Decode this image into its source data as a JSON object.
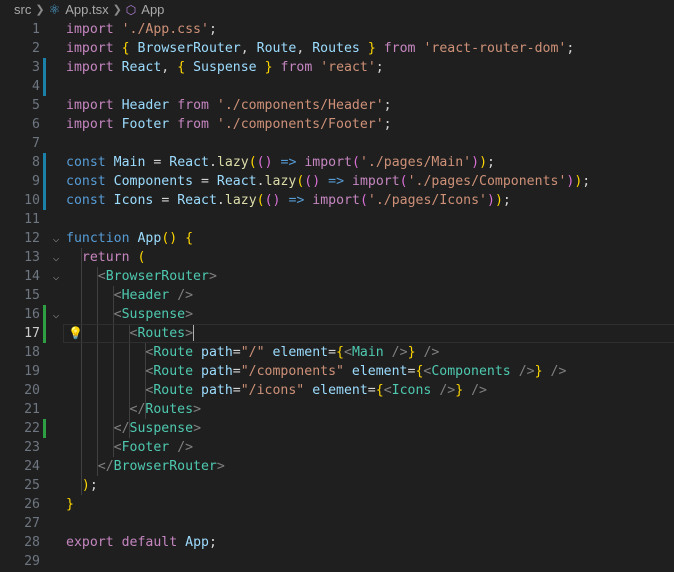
{
  "breadcrumb": {
    "folder": "src",
    "file": "App.tsx",
    "symbol": "App"
  },
  "editor": {
    "active_line": 17,
    "lines": [
      {
        "n": "1",
        "t": "import './App.css';"
      },
      {
        "n": "2",
        "t": "import { BrowserRouter, Route, Routes } from 'react-router-dom';"
      },
      {
        "n": "3",
        "t": "import React, { Suspense } from 'react';"
      },
      {
        "n": "4",
        "t": ""
      },
      {
        "n": "5",
        "t": "import Header from './components/Header';"
      },
      {
        "n": "6",
        "t": "import Footer from './components/Footer';"
      },
      {
        "n": "7",
        "t": ""
      },
      {
        "n": "8",
        "t": "const Main = React.lazy(() => import('./pages/Main'));"
      },
      {
        "n": "9",
        "t": "const Components = React.lazy(() => import('./pages/Components'));"
      },
      {
        "n": "10",
        "t": "const Icons = React.lazy(() => import('./pages/Icons'));"
      },
      {
        "n": "11",
        "t": ""
      },
      {
        "n": "12",
        "t": "function App() {"
      },
      {
        "n": "13",
        "t": "  return ("
      },
      {
        "n": "14",
        "t": "    <BrowserRouter>"
      },
      {
        "n": "15",
        "t": "      <Header />"
      },
      {
        "n": "16",
        "t": "      <Suspense>"
      },
      {
        "n": "17",
        "t": "        <Routes>"
      },
      {
        "n": "18",
        "t": "          <Route path=\"/\" element={<Main />} />"
      },
      {
        "n": "19",
        "t": "          <Route path=\"/components\" element={<Components />} />"
      },
      {
        "n": "20",
        "t": "          <Route path=\"/icons\" element={<Icons />} />"
      },
      {
        "n": "21",
        "t": "        </Routes>"
      },
      {
        "n": "22",
        "t": "      </Suspense>"
      },
      {
        "n": "23",
        "t": "      <Footer />"
      },
      {
        "n": "24",
        "t": "    </BrowserRouter>"
      },
      {
        "n": "25",
        "t": "  );"
      },
      {
        "n": "26",
        "t": "}"
      },
      {
        "n": "27",
        "t": ""
      },
      {
        "n": "28",
        "t": "export default App;"
      },
      {
        "n": "29",
        "t": ""
      }
    ]
  },
  "colors": {
    "background": "#1f1f1f",
    "keyword": "#c586c0",
    "storage": "#569cd6",
    "string": "#ce9178",
    "variable": "#9cdcfe",
    "type": "#4ec9b0",
    "function": "#dcdcaa",
    "modified_gutter": "#1b81a8",
    "added_gutter": "#2ea043"
  },
  "icons": [
    "chevron-right-icon",
    "react-icon",
    "symbol-method-icon",
    "fold-chevron-icon",
    "lightbulb-icon"
  ]
}
